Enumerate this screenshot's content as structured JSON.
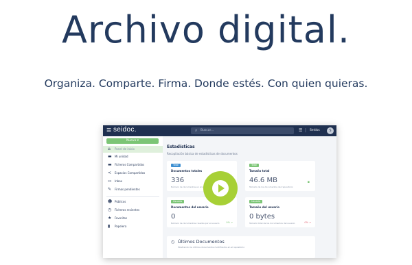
{
  "hero": {
    "title": "Archivo digital.",
    "subtitle": "Organiza. Comparte. Firma. Donde estés. Con quien quieras."
  },
  "app": {
    "brand": "seidoc.",
    "search_placeholder": "Buscar...",
    "user_name": "Seidoc",
    "avatar_initial": "S",
    "sidebar": {
      "new_button": "Nuevo",
      "items": [
        {
          "label": "Panel de inicio",
          "icon": "home-icon",
          "active": true
        },
        {
          "label": "Mi unidad",
          "icon": "folder-icon"
        },
        {
          "label": "Ficheros Compartidos",
          "icon": "shared-folder-icon"
        },
        {
          "label": "Espacios Compartidos",
          "icon": "share-icon"
        },
        {
          "label": "Inbox",
          "icon": "inbox-icon"
        },
        {
          "label": "Firmas pendientes",
          "icon": "signature-icon"
        },
        {
          "label": "Públicos",
          "icon": "users-icon"
        },
        {
          "label": "Ficheros recientes",
          "icon": "clock-icon"
        },
        {
          "label": "Favoritos",
          "icon": "star-icon"
        },
        {
          "label": "Papelera",
          "icon": "trash-icon"
        }
      ]
    },
    "main": {
      "title": "Estadísticas",
      "description": "Recopilación básica de estadísticas de documentos",
      "cards": [
        {
          "badge": "Total",
          "label": "Documentos totales",
          "value": "336",
          "note": "Número de documentos en el sistema",
          "pct": "",
          "badge_color": "#3d8fd1"
        },
        {
          "badge": "Total",
          "label": "Tamaño total",
          "value": "46.6 MB",
          "note": "Tamaño de los documentos del repositorio",
          "pct": "",
          "badge_color": "#7cc576"
        },
        {
          "badge": "Usuario",
          "label": "Documentos del usuario",
          "value": "0",
          "note": "Número de documentos creados por el usuario",
          "pct": "0% ↗",
          "pct_color": "#7cc576",
          "badge_color": "#7cc576"
        },
        {
          "badge": "Usuario",
          "label": "Tamaño del usuario",
          "value": "0 bytes",
          "note": "Tamaño total de los documentos del usuario",
          "pct": "0% ↗",
          "pct_color": "#e05a6a",
          "badge_color": "#7cc576"
        }
      ],
      "recent": {
        "title": "Últimos Documentos",
        "subtitle": "Mostrando los últimos documentos modificados en el repositorio"
      }
    }
  },
  "colors": {
    "topbar": "#1f3050",
    "accent_green": "#7cc576",
    "play": "#a7d036"
  }
}
